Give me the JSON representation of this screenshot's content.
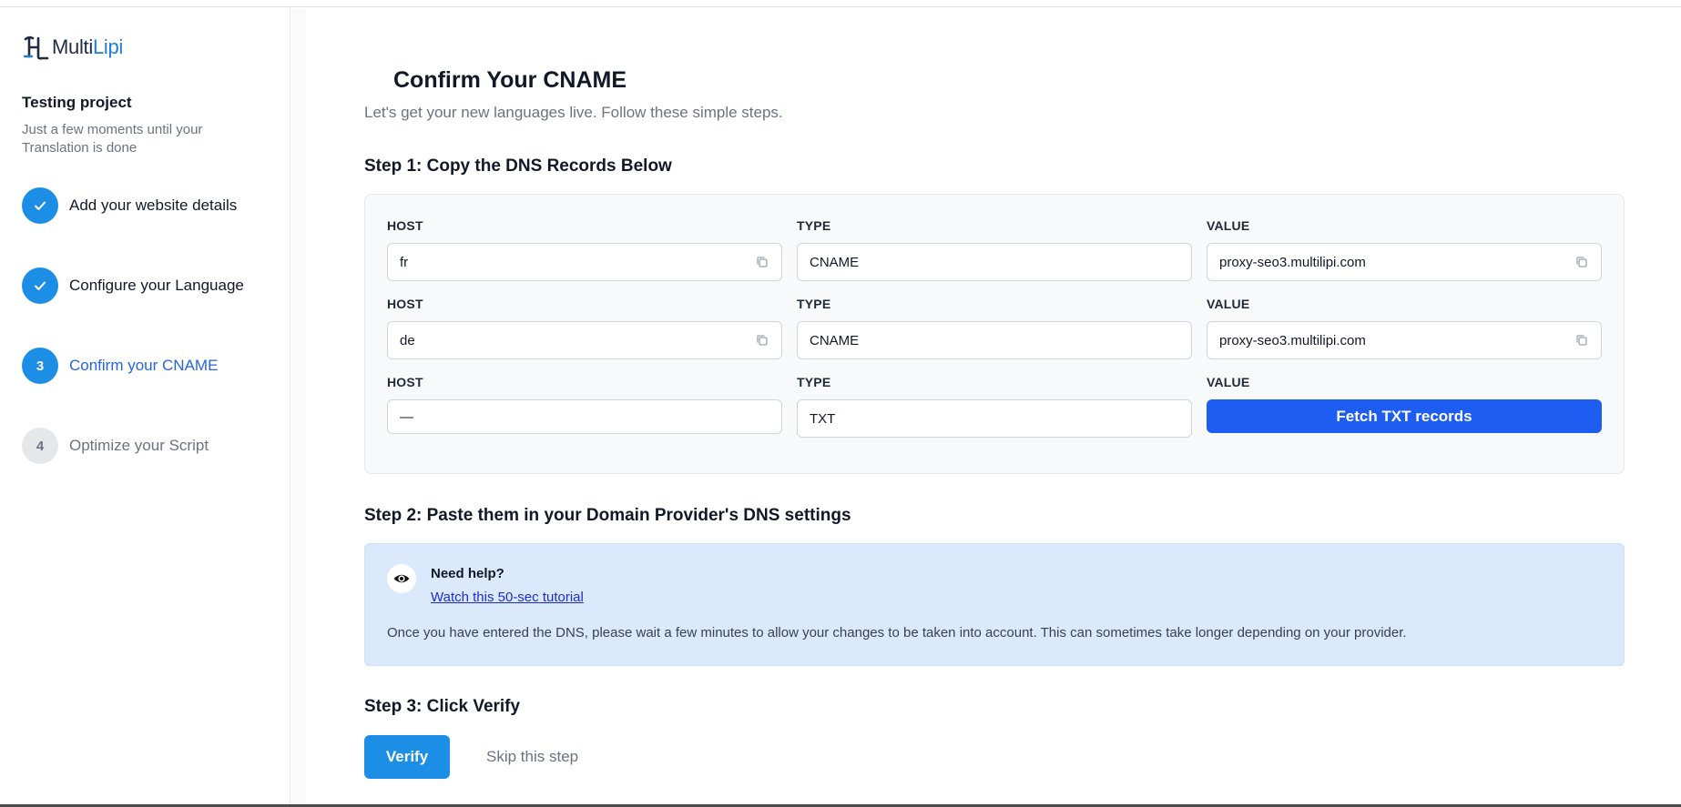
{
  "brand": {
    "name_part1": "Multi",
    "name_part2": "Lipi",
    "accent": "#1d7fd6"
  },
  "project": {
    "title": "Testing project",
    "subtitle": "Just a few moments until your Translation is done"
  },
  "steps": [
    {
      "number": "1",
      "label": "Add your website details",
      "state": "done",
      "icon": "check-icon"
    },
    {
      "number": "2",
      "label": "Configure your Language",
      "state": "done",
      "icon": "check-icon"
    },
    {
      "number": "3",
      "label": "Confirm your CNAME",
      "state": "active"
    },
    {
      "number": "4",
      "label": "Optimize your Script",
      "state": "todo"
    }
  ],
  "main": {
    "title": "Confirm Your CNAME",
    "subtitle": "Let's get your new languages live. Follow these simple steps.",
    "step1_heading": "Step 1: Copy the DNS Records Below",
    "step2_heading": "Step 2: Paste them in your Domain Provider's DNS settings",
    "step3_heading": "Step 3: Click Verify"
  },
  "dns": {
    "host_label": "HOST",
    "type_label": "TYPE",
    "value_label": "VALUE",
    "records": [
      {
        "host": "fr",
        "type": "CNAME",
        "value": "proxy-seo3.multilipi.com"
      },
      {
        "host": "de",
        "type": "CNAME",
        "value": "proxy-seo3.multilipi.com"
      },
      {
        "host": "—",
        "type": "TXT",
        "value_button": "Fetch TXT records"
      }
    ]
  },
  "help": {
    "title": "Need help?",
    "link": "Watch this 50-sec tutorial",
    "note": "Once you have entered the DNS, please wait a few minutes to allow your changes to be taken into account. This can sometimes take longer depending on your provider.",
    "icon": "eye-icon"
  },
  "actions": {
    "verify": "Verify",
    "skip": "Skip this step"
  },
  "colors": {
    "primary": "#1d8ee6",
    "fetch_button": "#1d5df2",
    "help_bg": "#dbe9fc"
  }
}
